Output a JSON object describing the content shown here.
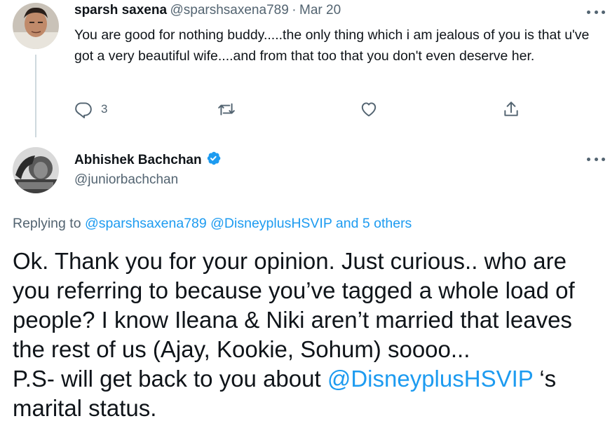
{
  "reply_tweet": {
    "display_name": "sparsh saxena",
    "handle": "@sparshsaxena789",
    "separator": "·",
    "date": "Mar 20",
    "text": "You are good for nothing buddy.....the only thing which i am jealous of you is that u've got a very beautiful wife....and from that too that you don't even deserve her.",
    "reply_count": "3",
    "icons": [
      "more-icon",
      "reply-icon",
      "retweet-icon",
      "like-icon",
      "share-icon"
    ]
  },
  "main_tweet": {
    "display_name": "Abhishek Bachchan",
    "handle": "@juniorbachchan",
    "verified_icon": "verified-badge-icon",
    "replying_prefix": "Replying to",
    "replying_mentions": "@sparshsaxena789 @DisneyplusHSVIP and 5 others",
    "text_line1": "Ok. Thank you for your opinion. Just curious.. who are",
    "text_line2": "you referring to because you’ve tagged a whole load of",
    "text_line3": "people? I know Ileana & Niki aren’t married that leaves",
    "text_line4": "the rest of us (Ajay, Kookie, Sohum) soooo...",
    "text_line5_prefix": "P.S- will get back to you about ",
    "text_line5_mention": "@DisneyplusHSVIP",
    "text_line5_suffix": " ‘s",
    "text_line6": "marital status."
  },
  "colors": {
    "link": "#1d9bf0",
    "secondary_text": "#536471",
    "primary_text": "#0f1419",
    "verified": "#1d9bf0"
  }
}
